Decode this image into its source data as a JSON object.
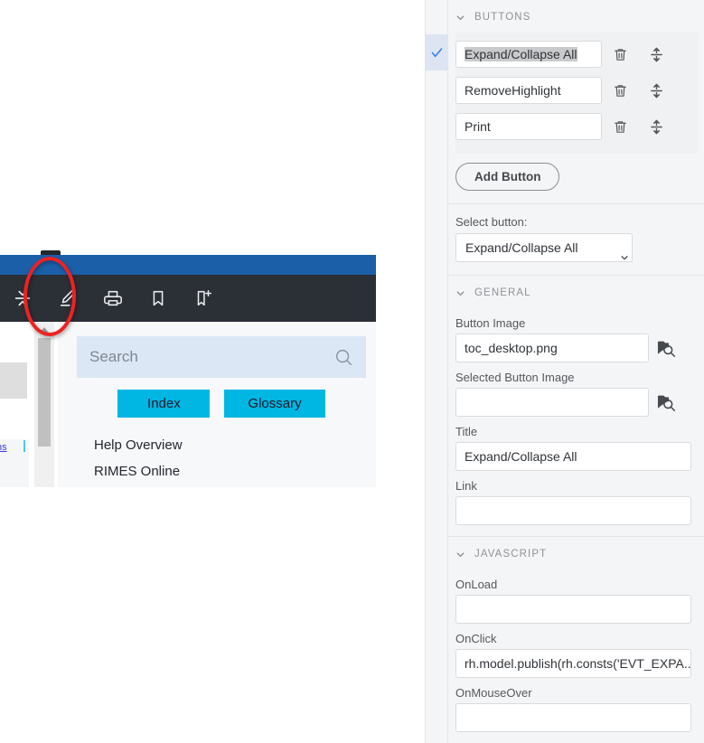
{
  "preview": {
    "toolbar_icons": [
      {
        "name": "expand-collapse-all-icon",
        "title": "Expand/Collapse All"
      },
      {
        "name": "highlighter-icon",
        "title": "RemoveHighlight"
      },
      {
        "name": "print-icon",
        "title": "Print"
      },
      {
        "name": "bookmark-icon",
        "title": "Bookmark"
      },
      {
        "name": "add-bookmark-icon",
        "title": "Add Bookmark"
      }
    ],
    "search_placeholder": "Search",
    "index_label": "Index",
    "glossary_label": "Glossary",
    "links": [
      "Help Overview",
      "RIMES Online"
    ],
    "doc_link_fragment": "ns",
    "colors": {
      "header_blue": "#1a5fa8",
      "toolbar_dark": "#2b2f36",
      "search_bg": "#dbe7f5",
      "pill_cyan": "#00b6e3",
      "annotation_red": "#ee2222"
    }
  },
  "settings": {
    "buttons_section": {
      "title": "BUTTONS",
      "items": [
        {
          "label": "Expand/Collapse All",
          "selected": true
        },
        {
          "label": "RemoveHighlight",
          "selected": false
        },
        {
          "label": "Print",
          "selected": false
        }
      ],
      "delete_icon": "trash-icon",
      "reorder_icon": "move-vertical-icon",
      "add_button_label": "Add Button"
    },
    "select_button": {
      "label": "Select button:",
      "value": "Expand/Collapse All"
    },
    "general_section": {
      "title": "GENERAL",
      "fields": [
        {
          "label": "Button Image",
          "value": "toc_desktop.png",
          "browse": true
        },
        {
          "label": "Selected Button Image",
          "value": "",
          "browse": true
        },
        {
          "label": "Title",
          "value": "Expand/Collapse All",
          "browse": false
        },
        {
          "label": "Link",
          "value": "",
          "browse": false
        }
      ]
    },
    "javascript_section": {
      "title": "JAVASCRIPT",
      "fields": [
        {
          "label": "OnLoad",
          "value": ""
        },
        {
          "label": "OnClick",
          "value": "rh.model.publish(rh.consts('EVT_EXPA..."
        },
        {
          "label": "OnMouseOver",
          "value": ""
        }
      ]
    },
    "colors": {
      "panel_bg": "#f4f5f6",
      "accent_check": "#3b82dd",
      "row_highlight": "#dde5f2"
    }
  }
}
